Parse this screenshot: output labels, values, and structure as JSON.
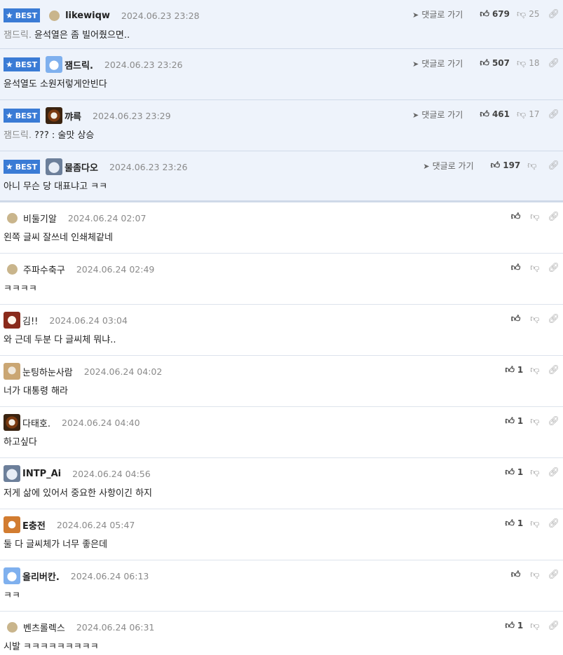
{
  "labels": {
    "best": "BEST",
    "reply": "댓글로 가기"
  },
  "colors": {
    "best_bg": "#eef3fb",
    "badge": "#3a7bd5",
    "default_avatar": "#c9b58c"
  },
  "icons": {
    "best": "star-icon",
    "reply": "reply-arrow-icon",
    "up": "thumbs-up-icon",
    "down": "thumbs-down-icon",
    "link": "link-icon"
  },
  "best_comments": [
    {
      "nick": "likewiqw",
      "date": "2024.06.23 23:28",
      "mention": "잼드릭.",
      "text": "윤석열은 좀 빌어줬으면..",
      "up": "679",
      "down": "25"
    },
    {
      "nick": "잼드릭.",
      "date": "2024.06.23 23:26",
      "mention": "",
      "text": "윤석열도 소원저렇게안빈다",
      "up": "507",
      "down": "18"
    },
    {
      "nick": "꺄륵",
      "date": "2024.06.23 23:29",
      "mention": "잼드릭.",
      "text": "??? : 술맛 상승",
      "up": "461",
      "down": "17"
    },
    {
      "nick": "물좀다오",
      "date": "2024.06.23 23:26",
      "mention": "",
      "text": "아니 무슨 당 대표냐고 ㅋㅋ",
      "up": "197",
      "down": ""
    }
  ],
  "comments": [
    {
      "nick": "비둘기알",
      "date": "2024.06.24 02:07",
      "text": "왼쪽 글씨 잘쓰네 인쇄체같네",
      "up": ""
    },
    {
      "nick": "주파수축구",
      "date": "2024.06.24 02:49",
      "text": "ㅋㅋㅋㅋ",
      "up": ""
    },
    {
      "nick": "김!!",
      "date": "2024.06.24 03:04",
      "text": "와 근데 두분 다 글씨체 뭐냐..",
      "up": ""
    },
    {
      "nick": "눈팅하눈사람",
      "date": "2024.06.24 04:02",
      "text": "너가 대통령 해라",
      "up": "1"
    },
    {
      "nick": "다태호.",
      "date": "2024.06.24 04:40",
      "text": "하고싶다",
      "up": "1"
    },
    {
      "nick": "INTP_Ai",
      "date": "2024.06.24 04:56",
      "text": "저게 삶에 있어서 중요한 사항이긴 하지",
      "up": "1"
    },
    {
      "nick": "E충전",
      "date": "2024.06.24 05:47",
      "text": "둘 다 글씨체가 너무 좋은데",
      "up": "1"
    },
    {
      "nick": "올리버칸.",
      "date": "2024.06.24 06:13",
      "text": "ㅋㅋ",
      "up": ""
    },
    {
      "nick": "벤츠롤렉스",
      "date": "2024.06.24 06:31",
      "text": "시발 ㅋㅋㅋㅋㅋㅋㅋㅋㅋ",
      "up": "1"
    }
  ]
}
